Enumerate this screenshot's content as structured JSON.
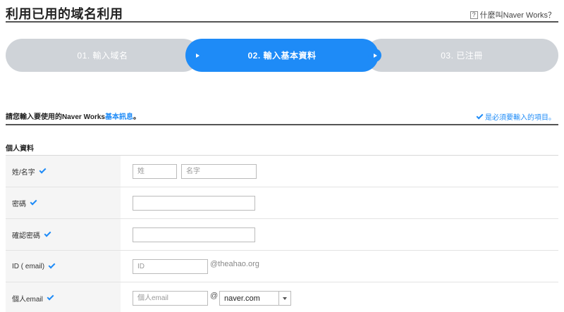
{
  "header": {
    "title": "利用已用的域名利用",
    "help_icon": "?",
    "help_label": "什麼叫Naver Works？"
  },
  "steps": [
    {
      "label": "01. 輸入域名",
      "state": "done"
    },
    {
      "label": "02. 輸入基本資料",
      "state": "active"
    },
    {
      "label": "03. 已注冊",
      "state": "pending"
    }
  ],
  "colors": {
    "accent": "#1e8bf7",
    "step_inactive": "#cfd3d8"
  },
  "intro": {
    "prefix": "請您輸入要使用的Naver Works",
    "highlight": "基本訊息",
    "suffix": "。",
    "required_note": "是必須要輸入的項目。"
  },
  "section": {
    "title": "個人資料"
  },
  "form": {
    "name": {
      "label": "姓/名字",
      "last_placeholder": "姓",
      "first_placeholder": "名字"
    },
    "password": {
      "label": "密碼"
    },
    "confirm_password": {
      "label": "確認密碼"
    },
    "id": {
      "label": "ID ( email)",
      "placeholder": "ID",
      "domain": "@theahao.org"
    },
    "personal_email": {
      "label": "個人email",
      "placeholder": "個人email",
      "at": "@",
      "domain_selected": "naver.com"
    }
  }
}
